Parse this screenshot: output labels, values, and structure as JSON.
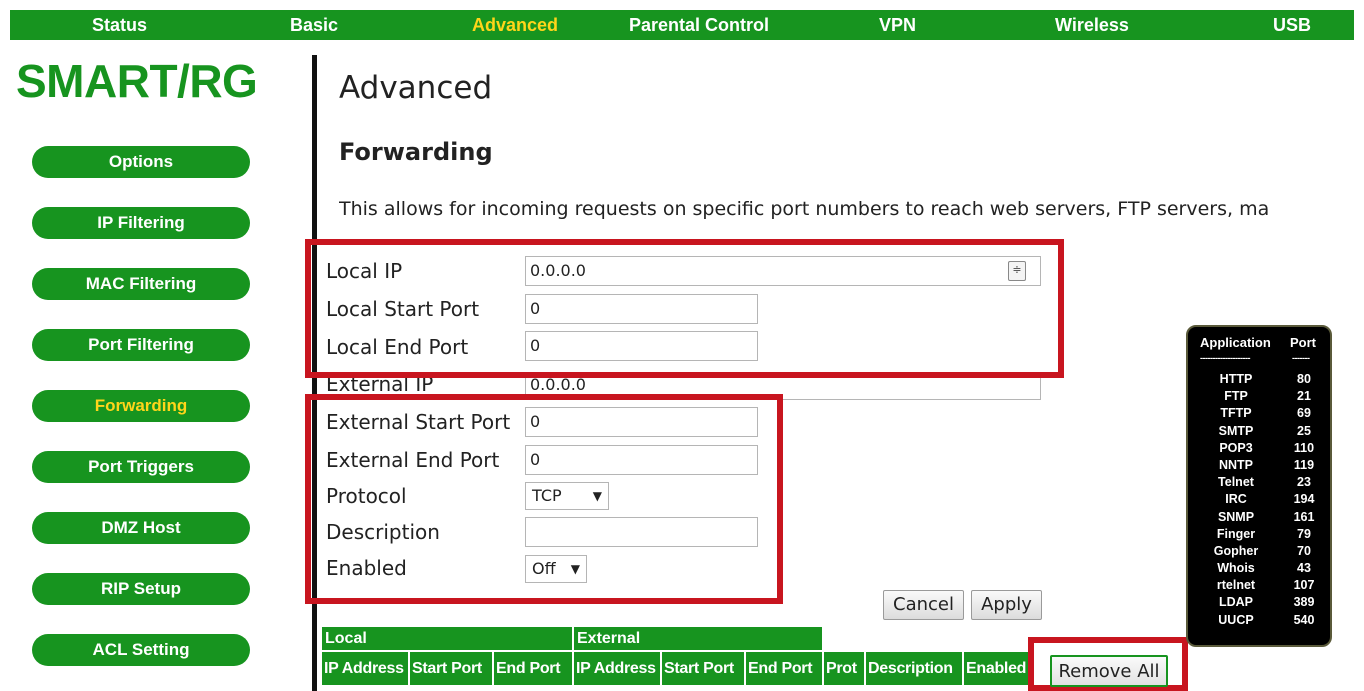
{
  "nav": {
    "items": [
      {
        "label": "Status"
      },
      {
        "label": "Basic"
      },
      {
        "label": "Advanced"
      },
      {
        "label": "Parental Control"
      },
      {
        "label": "VPN"
      },
      {
        "label": "Wireless"
      },
      {
        "label": "USB"
      }
    ],
    "active": "Advanced"
  },
  "logo": {
    "text": "SMART/RG"
  },
  "sidebar": {
    "items": [
      {
        "label": "Options"
      },
      {
        "label": "IP Filtering"
      },
      {
        "label": "MAC Filtering"
      },
      {
        "label": "Port Filtering"
      },
      {
        "label": "Forwarding"
      },
      {
        "label": "Port Triggers"
      },
      {
        "label": "DMZ Host"
      },
      {
        "label": "RIP Setup"
      },
      {
        "label": "ACL Setting"
      }
    ],
    "active": "Forwarding"
  },
  "page": {
    "title": "Advanced",
    "section": "Forwarding",
    "description": "This allows for incoming requests on specific port numbers to reach web servers, FTP servers, ma"
  },
  "form": {
    "local_ip": {
      "label": "Local IP",
      "value": "0.0.0.0"
    },
    "local_start_port": {
      "label": "Local Start Port",
      "value": "0"
    },
    "local_end_port": {
      "label": "Local End Port",
      "value": "0"
    },
    "external_ip": {
      "label": "External IP",
      "value": "0.0.0.0"
    },
    "external_start_port": {
      "label": "External Start Port",
      "value": "0"
    },
    "external_end_port": {
      "label": "External End Port",
      "value": "0"
    },
    "protocol": {
      "label": "Protocol",
      "value": "TCP"
    },
    "description": {
      "label": "Description",
      "value": ""
    },
    "enabled": {
      "label": "Enabled",
      "value": "Off"
    }
  },
  "buttons": {
    "cancel": "Cancel",
    "apply": "Apply",
    "remove_all": "Remove All"
  },
  "port_reference": {
    "header_app": "Application",
    "header_port": "Port",
    "dashes_app": "--------------------",
    "dashes_port": "-------",
    "rows": [
      {
        "name": "HTTP",
        "port": "80"
      },
      {
        "name": "FTP",
        "port": "21"
      },
      {
        "name": "TFTP",
        "port": "69"
      },
      {
        "name": "SMTP",
        "port": "25"
      },
      {
        "name": "POP3",
        "port": "110"
      },
      {
        "name": "NNTP",
        "port": "119"
      },
      {
        "name": "Telnet",
        "port": "23"
      },
      {
        "name": "IRC",
        "port": "194"
      },
      {
        "name": "SNMP",
        "port": "161"
      },
      {
        "name": "Finger",
        "port": "79"
      },
      {
        "name": "Gopher",
        "port": "70"
      },
      {
        "name": "Whois",
        "port": "43"
      },
      {
        "name": "rtelnet",
        "port": "107"
      },
      {
        "name": "LDAP",
        "port": "389"
      },
      {
        "name": "UUCP",
        "port": "540"
      }
    ]
  },
  "table": {
    "group_local": "Local",
    "group_external": "External",
    "columns": [
      "IP Address",
      "Start Port",
      "End Port",
      "IP Address",
      "Start Port",
      "End Port",
      "Prot",
      "Description",
      "Enabled"
    ]
  },
  "colors": {
    "brand_green": "#17941f",
    "active_yellow": "#ffd51a",
    "highlight_red": "#c8151f"
  }
}
